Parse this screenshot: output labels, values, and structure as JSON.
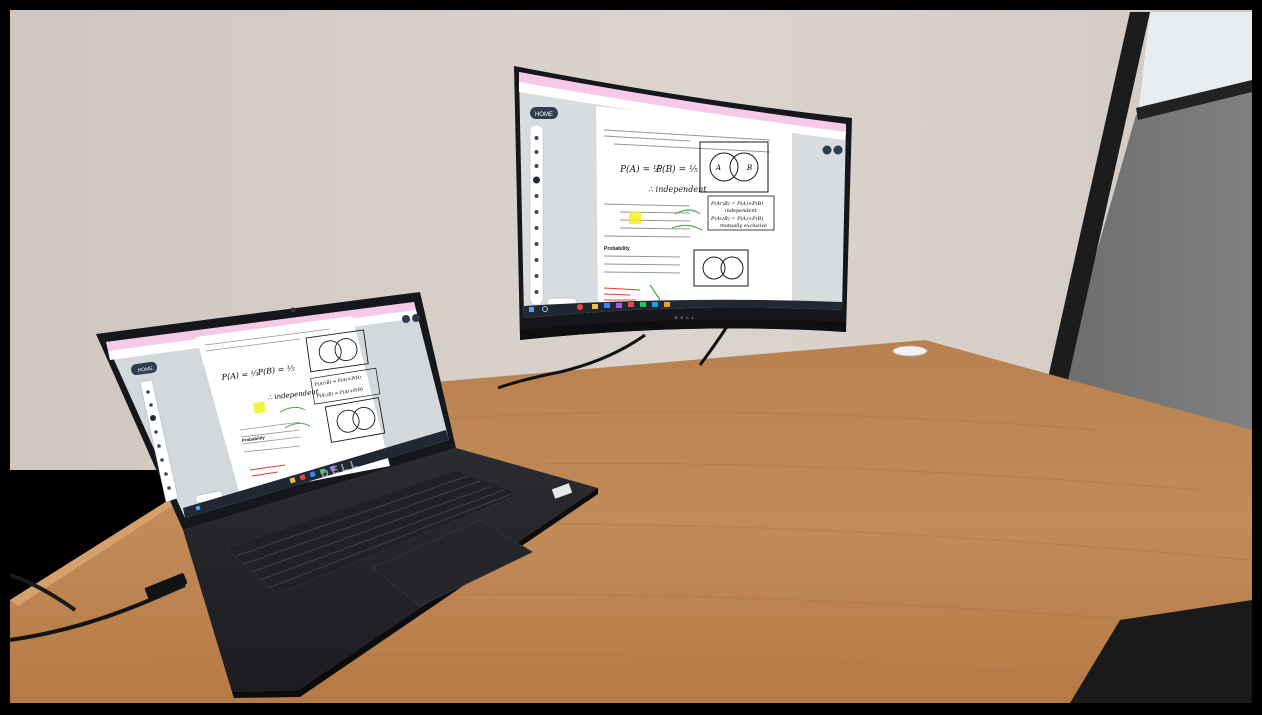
{
  "scene": {
    "laptop_brand": "DELL",
    "monitor_brand": "DELL"
  },
  "screen": {
    "home_button": "HOME",
    "venn_labels": [
      "A",
      "B"
    ],
    "notes": {
      "prob_a": "P(A) = ⅓",
      "prob_b": "P(B) = ⅕",
      "independent": "∴ independent",
      "box_line_1": "P(A∩B) = P(A)×P(B)",
      "box_line_2": "independent",
      "box_line_3": "P(A∪B) = P(A)+P(B)",
      "box_line_4": "mutually exclusive"
    },
    "section_heading": "Probability",
    "text_lines_count": 8
  },
  "colors": {
    "wall": "#d8d0c9",
    "desk": "#c08a55",
    "bezel": "#15171a",
    "page": "#ffffff",
    "browser_tab": "#f7c9e8",
    "highlighter": "#f2f21e",
    "ink_green": "#4ea84e",
    "ink_red": "#d9412f",
    "taskbar": "#202833"
  },
  "icons": [
    "home-icon",
    "pen-icon",
    "eraser-icon",
    "text-icon",
    "undo-icon",
    "zoom-icon",
    "windows-icon",
    "search-icon",
    "chrome-icon",
    "folder-icon"
  ]
}
